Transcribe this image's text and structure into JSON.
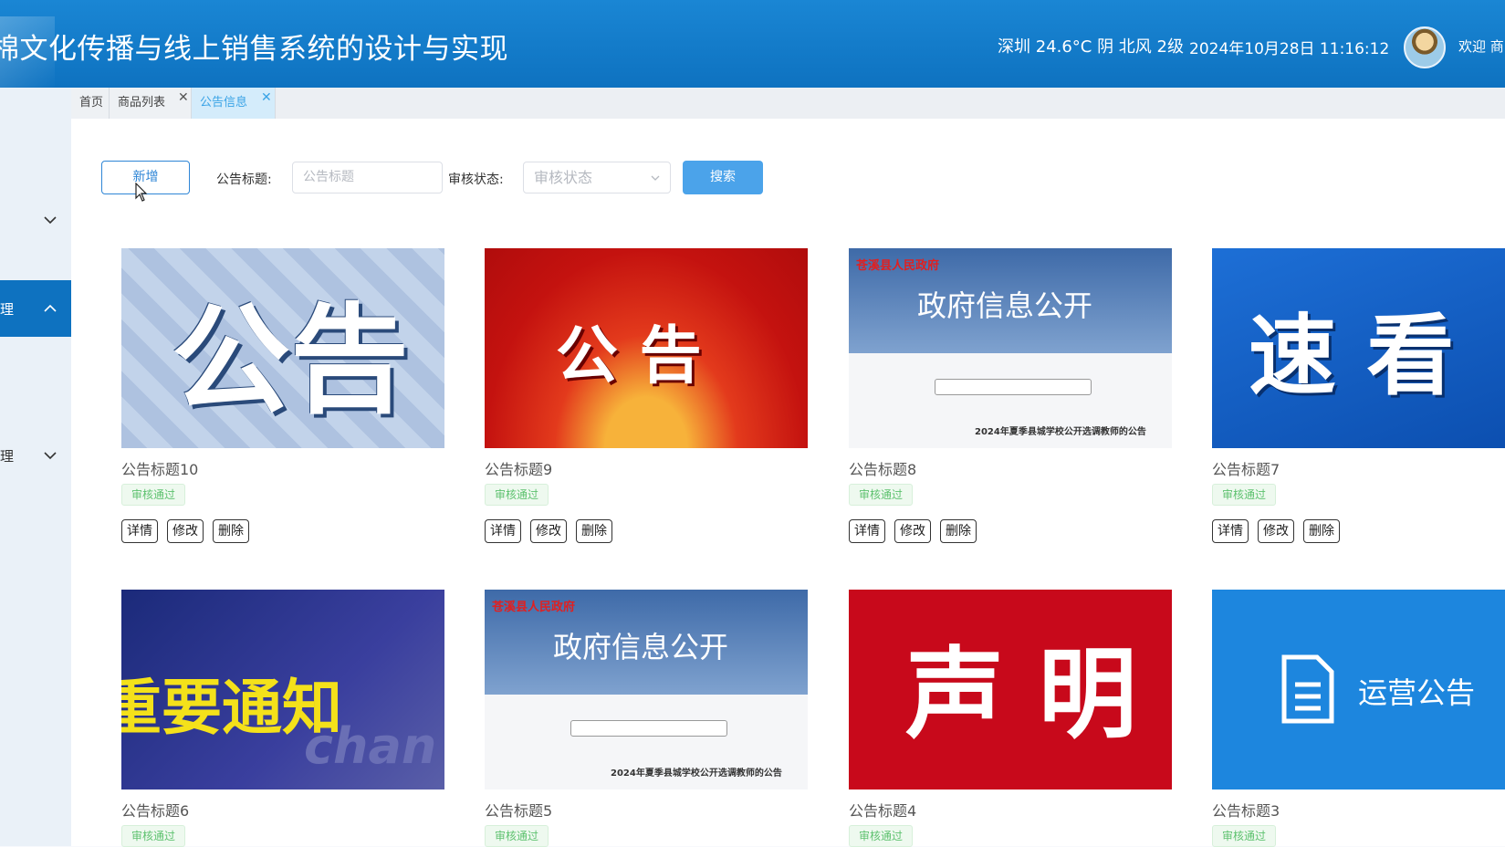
{
  "header": {
    "title": "棉文化传播与线上销售系统的设计与实现",
    "weather": "深圳 24.6°C 阴 北风 2级",
    "datetime": "2024年10月28日 11:16:12",
    "welcome": "欢迎 商"
  },
  "sidebar": {
    "items": [
      {
        "label": "",
        "expanded": false
      },
      {
        "label": "理",
        "expanded": true
      },
      {
        "label": "理",
        "expanded": false
      }
    ]
  },
  "tabs": [
    {
      "label": "首页",
      "closable": false,
      "active": false
    },
    {
      "label": "商品列表",
      "closable": true,
      "active": false
    },
    {
      "label": "公告信息",
      "closable": true,
      "active": true
    }
  ],
  "toolbar": {
    "add_label": "新增",
    "title_label": "公告标题:",
    "title_placeholder": "公告标题",
    "status_label": "审核状态:",
    "status_placeholder": "审核状态",
    "search_label": "搜索"
  },
  "cards": [
    {
      "title": "公告标题10",
      "status": "审核通过",
      "image_text": "公告"
    },
    {
      "title": "公告标题9",
      "status": "审核通过",
      "image_text": "公  告"
    },
    {
      "title": "公告标题8",
      "status": "审核通过",
      "image_text": "政府信息公开",
      "image_org": "苍溪县人民政府",
      "image_caption": "2024年夏季县城学校公开选调教师的公告"
    },
    {
      "title": "公告标题7",
      "status": "审核通过",
      "image_text": "速    看"
    },
    {
      "title": "公告标题6",
      "status": "审核通过",
      "image_text": "重要通知",
      "image_extra": "chan"
    },
    {
      "title": "公告标题5",
      "status": "审核通过",
      "image_text": "政府信息公开",
      "image_org": "苍溪县人民政府",
      "image_caption": "2024年夏季县城学校公开选调教师的公告"
    },
    {
      "title": "公告标题4",
      "status": "审核通过",
      "image_text": "声 明"
    },
    {
      "title": "公告标题3",
      "status": "审核通过",
      "image_text": "运营公告"
    }
  ],
  "card_actions": {
    "detail": "详情",
    "edit": "修改",
    "delete": "删除"
  },
  "colors": {
    "header_bg": "#0e72c0",
    "primary": "#2f86d6",
    "search_btn": "#4ba3ea",
    "approved_green": "#5ec26f",
    "active_tab_bg": "#d4ecfb"
  }
}
